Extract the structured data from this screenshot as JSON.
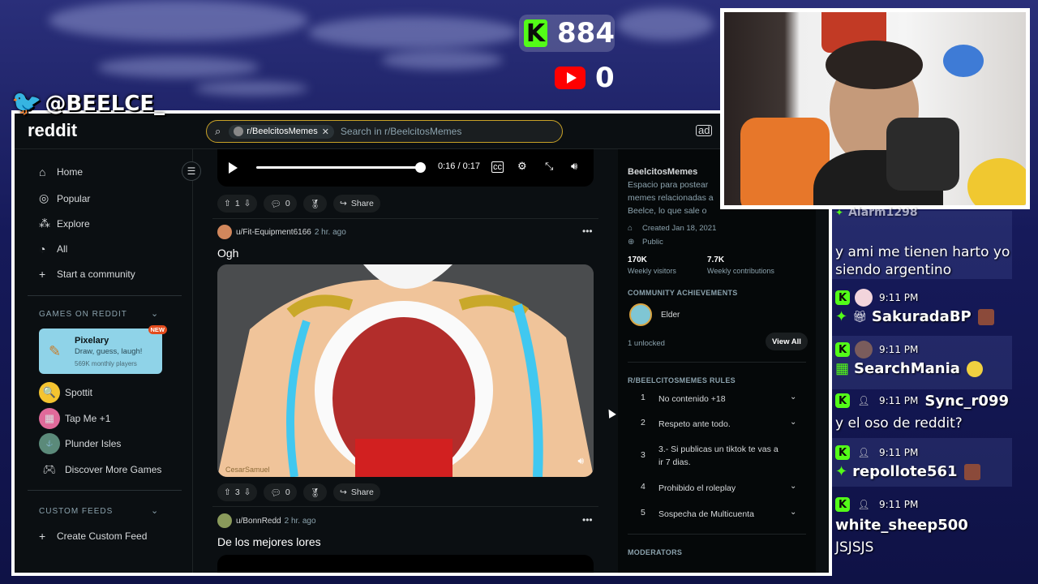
{
  "overlay": {
    "kick_count": "884",
    "youtube_count": "0",
    "twitter_handle": "@BEELCE_"
  },
  "topbar": {
    "logo": "reddit",
    "search_chip": "r/BeelcitosMemes",
    "search_placeholder": "Search in r/BeelcitosMemes"
  },
  "sidebar": {
    "nav": [
      "Home",
      "Popular",
      "Explore",
      "All",
      "Start a community"
    ],
    "games_title": "GAMES ON REDDIT",
    "featured_game": {
      "name": "Pixelary",
      "tagline": "Draw, guess, laugh!",
      "players": "569K monthly players",
      "badge": "NEW"
    },
    "games": [
      "Spottit",
      "Tap Me +1",
      "Plunder Isles",
      "Discover More Games"
    ],
    "feeds_title": "CUSTOM FEEDS",
    "create_feed": "Create Custom Feed"
  },
  "feed": {
    "video_time": "0:16 / 0:17",
    "post0_votes": "1",
    "post0_comments": "0",
    "share_label": "Share",
    "post1": {
      "author": "u/Fit-Equipment6166",
      "age": "2 hr. ago",
      "title": "Ogh",
      "votes": "3",
      "comments": "0",
      "watermark": "CesarSamuel"
    },
    "post2": {
      "author": "u/BonnRedd",
      "age": "2 hr. ago",
      "title": "De los mejores lores"
    }
  },
  "community": {
    "name": "BeelcitosMemes",
    "description": "Espacio para postear memes relacionadas a Beelce, lo que sale o puede salir en Stream!",
    "created": "Created Jan 18, 2021",
    "visibility": "Public",
    "weekly_visitors": "170K",
    "weekly_visitors_label": "Weekly visitors",
    "weekly_contrib": "7.7K",
    "weekly_contrib_label": "Weekly contributions",
    "achievements_title": "COMMUNITY ACHIEVEMENTS",
    "achievement": "Elder",
    "unlocked": "1 unlocked",
    "view_all": "View All",
    "rules_title": "R/BEELCITOSMEMES RULES",
    "rules": [
      {
        "num": "1",
        "text": "No contenido +18"
      },
      {
        "num": "2",
        "text": "Respeto ante todo."
      },
      {
        "num": "3",
        "text": "3.- Si publicas un tiktok te vas a ir 7 dias."
      },
      {
        "num": "4",
        "text": "Prohibido el roleplay"
      },
      {
        "num": "5",
        "text": "Sospecha de Multicuenta"
      }
    ],
    "moderators_title": "MODERATORS"
  },
  "chat": {
    "partial_name": "Alarm1298",
    "msg0": "y ami me tienen harto yo siendo argentino",
    "messages": [
      {
        "time": "9:11 PM",
        "name": "SakuradaBP",
        "text": ""
      },
      {
        "time": "9:11 PM",
        "name": "SearchMania",
        "text": ""
      },
      {
        "time": "9:11 PM",
        "name": "Sync_r099",
        "text": "y el oso de reddit?"
      },
      {
        "time": "9:11 PM",
        "name": "repollote561",
        "text": ""
      },
      {
        "time": "9:11 PM",
        "name": "white_sheep500",
        "text": "JSJSJS"
      }
    ]
  }
}
